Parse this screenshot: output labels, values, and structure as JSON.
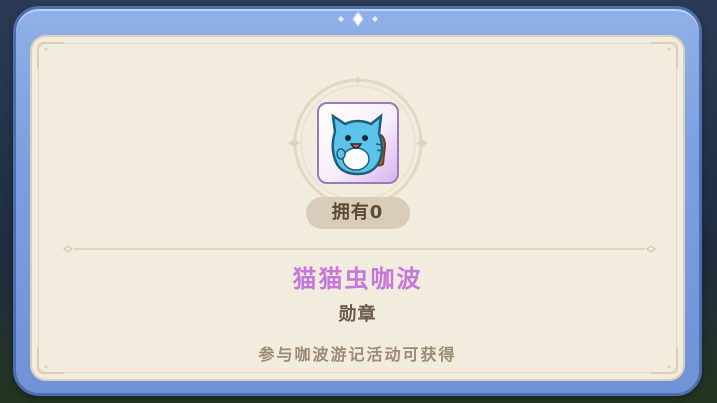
{
  "item": {
    "owned_label": "拥有0",
    "name": "猫猫虫咖波",
    "type": "勋章",
    "source": "参与咖波游记活动可获得",
    "icon": "bugcat-capoo-icon"
  },
  "colors": {
    "frame_blue": "#7b9fe0",
    "panel_cream": "#f2ecdf",
    "name_purple": "#c776d9",
    "type_brown": "#6a5a48",
    "source_tan": "#9c8a72",
    "pill_bg": "#d9cdb9"
  }
}
